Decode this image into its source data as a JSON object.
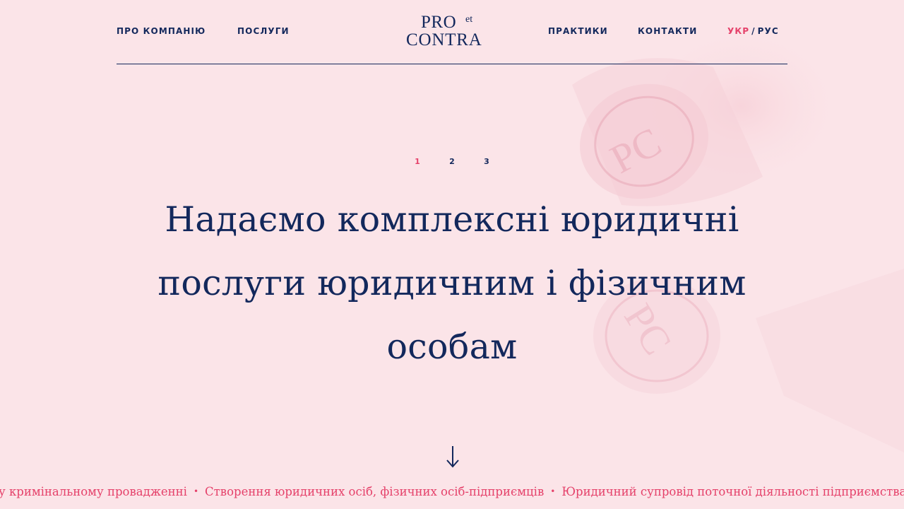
{
  "nav": {
    "about": "ПРО КОМПАНІЮ",
    "services": "ПОСЛУГИ",
    "practices": "ПРАКТИКИ",
    "contacts": "КОНТАКТИ"
  },
  "logo": {
    "pro": "PRO",
    "et": "et",
    "contra": "CONTRA"
  },
  "language": {
    "active": "УКР",
    "separator": "/",
    "other": "РУС"
  },
  "slider": {
    "numbers": [
      "1",
      "2",
      "3"
    ],
    "active_index": 0
  },
  "hero": {
    "headline": "Надаємо комплексні юридичні послуги юридичним і фізичним особам"
  },
  "ticker": {
    "items": [
      "у кримінальному провадженні",
      "Створення юридичних осіб, фізичних осіб-підприємців",
      "Юридичний супровід поточної діяльності підприємства"
    ],
    "separator": "•"
  },
  "icons": {
    "scroll": "arrow-down-icon",
    "background": "wax-seal-stamp-image"
  },
  "colors": {
    "background": "#fbe4e8",
    "primary": "#13285c",
    "accent": "#e5416a"
  }
}
